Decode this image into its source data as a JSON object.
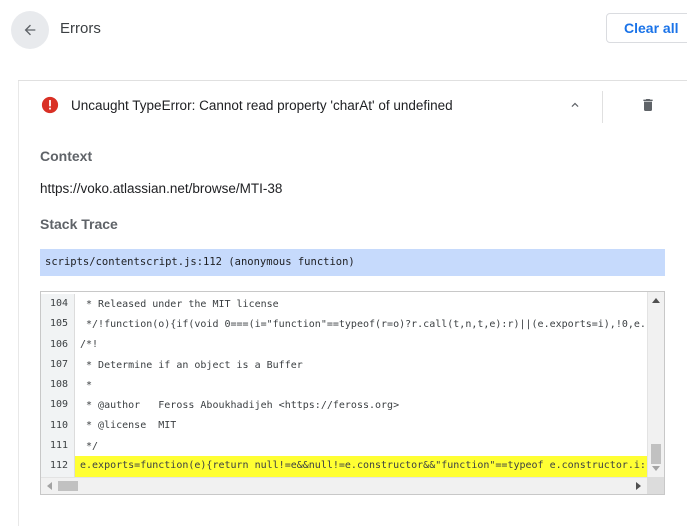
{
  "header": {
    "title": "Errors",
    "clear_all_label": "Clear all"
  },
  "error": {
    "message": "Uncaught TypeError: Cannot read property 'charAt' of undefined"
  },
  "context": {
    "heading": "Context",
    "url": "https://voko.atlassian.net/browse/MTI-38"
  },
  "stack_trace": {
    "heading": "Stack Trace",
    "frame": "scripts/contentscript.js:112 (anonymous function)"
  },
  "code": {
    "lines": [
      {
        "num": "104",
        "text": " * Released under the MIT license"
      },
      {
        "num": "105",
        "text": " */!function(o){if(void 0===(i=\"function\"==typeof(r=o)?r.call(t,n,t,e):r)||(e.exports=i),!0,e."
      },
      {
        "num": "106",
        "text": "/*!"
      },
      {
        "num": "107",
        "text": " * Determine if an object is a Buffer"
      },
      {
        "num": "108",
        "text": " *"
      },
      {
        "num": "109",
        "text": " * @author   Feross Aboukhadijeh <https://feross.org>"
      },
      {
        "num": "110",
        "text": " * @license  MIT"
      },
      {
        "num": "111",
        "text": " */"
      },
      {
        "num": "112",
        "text": "e.exports=function(e){return null!=e&&null!=e.constructor&&\"function\"==typeof e.constructor.i:"
      }
    ],
    "highlight_line": "112"
  },
  "colors": {
    "accent": "#1a73e8",
    "error_red": "#d93025",
    "frame_bg": "#c6dafc",
    "highlight": "#ffff33"
  },
  "icons": {
    "back": "arrow-back-icon",
    "error": "error-circle-icon",
    "collapse": "chevron-up-icon",
    "delete": "trash-icon"
  }
}
